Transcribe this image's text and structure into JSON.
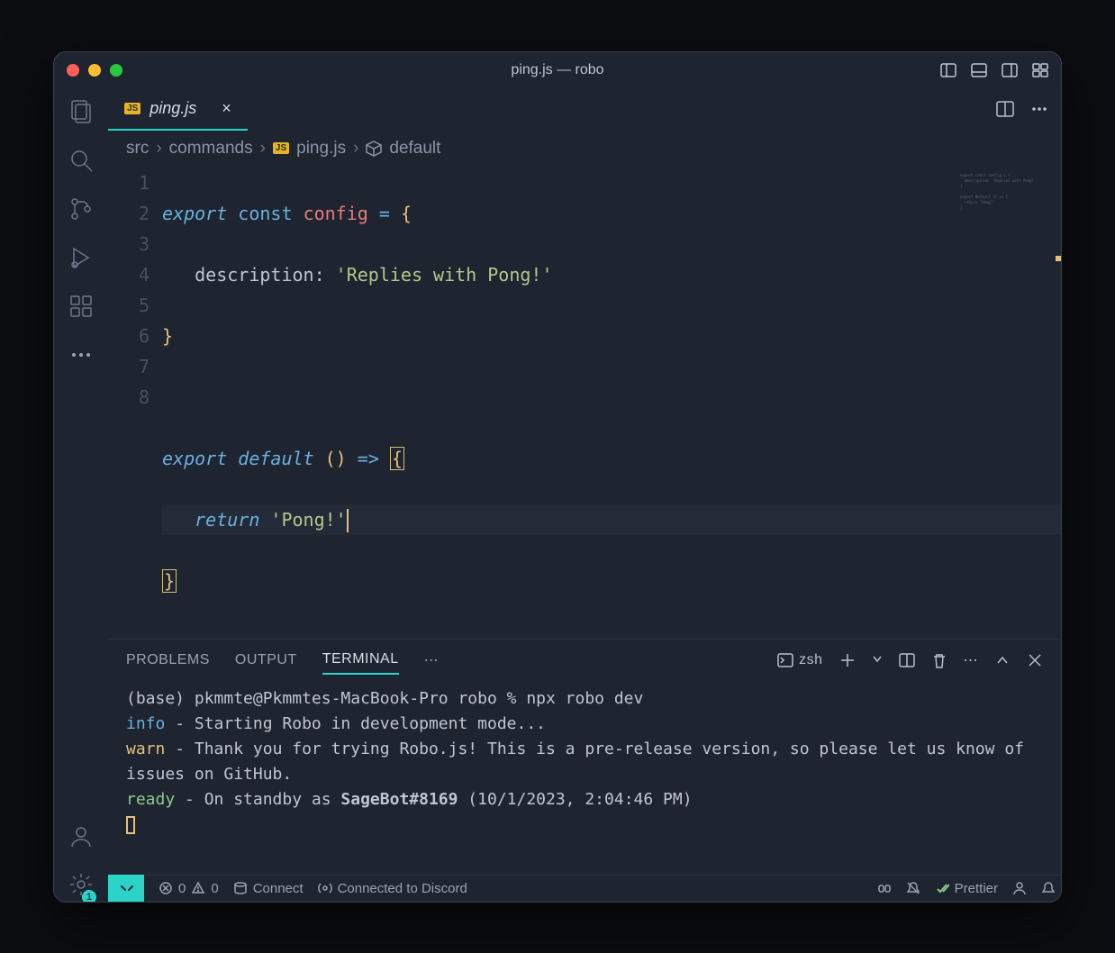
{
  "window": {
    "title": "ping.js — robo"
  },
  "traffic_lights": {
    "red": "#ff5f57",
    "yellow": "#febc2e",
    "green": "#28c840"
  },
  "activitybar": {
    "items": [
      "files",
      "search",
      "source-control",
      "run-debug",
      "extensions"
    ],
    "settings_badge": "1"
  },
  "tabs": {
    "active": {
      "icon": "JS",
      "label": "ping.js",
      "modified": false
    }
  },
  "breadcrumbs": {
    "segments": [
      "src",
      "commands",
      "ping.js",
      "default"
    ]
  },
  "editor": {
    "line_numbers": [
      "1",
      "2",
      "3",
      "4",
      "5",
      "6",
      "7",
      "8"
    ],
    "code": {
      "line1": {
        "export": "export",
        "const": "const",
        "ident": "config",
        "eq": "=",
        "brace": "{"
      },
      "line2": {
        "prop": "description",
        "colon": ":",
        "str": "'Replies with Pong!'"
      },
      "line3": {
        "brace": "}"
      },
      "line5": {
        "export": "export",
        "default": "default",
        "paren": "()",
        "arrow": "=>",
        "brace": "{"
      },
      "line6": {
        "return": "return",
        "str": "'Pong!'"
      },
      "line7": {
        "brace": "}"
      }
    }
  },
  "panel": {
    "tabs": {
      "problems": "PROBLEMS",
      "output": "OUTPUT",
      "terminal": "TERMINAL"
    },
    "shell": "zsh"
  },
  "terminal": {
    "prompt": "(base) pkmmte@Pkmmtes-MacBook-Pro robo % npx robo dev",
    "info_label": "info",
    "info_text": "  - Starting Robo in development mode...",
    "warn_label": "warn",
    "warn_text": "  - Thank you for trying Robo.js! This is a pre-release version, so please let us know of issues on GitHub.",
    "ready_label": "ready",
    "ready_prefix": " - On standby as ",
    "bot_name": "SageBot#8169",
    "ready_suffix": " (10/1/2023, 2:04:46 PM)"
  },
  "statusbar": {
    "errors": "0",
    "warnings": "0",
    "connect": "Connect",
    "discord": "Connected to Discord",
    "prettier": "Prettier"
  }
}
